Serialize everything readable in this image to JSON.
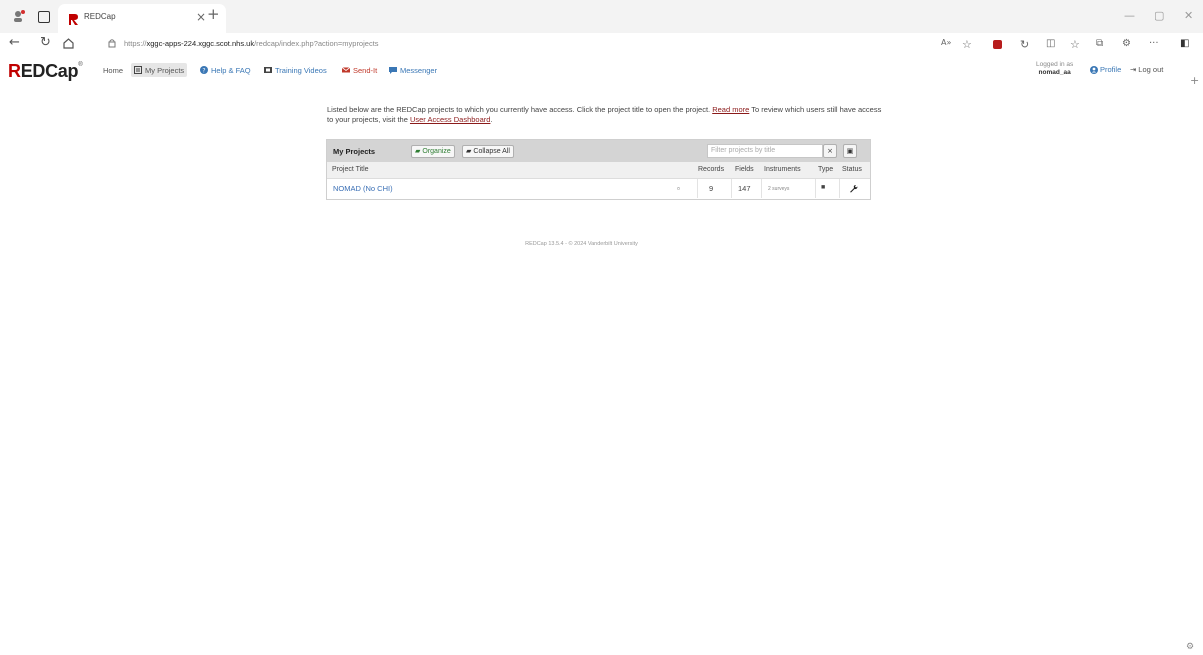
{
  "browser": {
    "tab_title": "REDCap",
    "url_prefix": "https://",
    "url_host": "xggc-apps-224.xggc.scot.nhs.uk",
    "url_path": "/redcap/index.php?action=myprojects"
  },
  "nav": {
    "logo_text": "EDCap",
    "logo_r": "R",
    "home": "Home",
    "my_projects": "My Projects",
    "help": "Help & FAQ",
    "training": "Training Videos",
    "sendit": "Send-It",
    "messenger": "Messenger",
    "logged_in_label": "Logged in as",
    "username": "nomad_aa",
    "profile": "Profile",
    "logout": "Log out"
  },
  "intro": {
    "text1": "Listed below are the REDCap projects to which you currently have access. Click the project title to open the project.",
    "read_more": "Read more",
    "text2": "To review which users still have access to your projects, visit the",
    "dashboard_link": "User Access Dashboard",
    "text3": "."
  },
  "projects": {
    "header_title": "My Projects",
    "organize": "Organize",
    "collapse_all": "Collapse All",
    "filter_placeholder": "Filter projects by title",
    "clear_btn": "×",
    "columns": {
      "title": "Project Title",
      "records": "Records",
      "fields": "Fields",
      "instruments": "Instruments",
      "type": "Type",
      "status": "Status"
    },
    "rows": [
      {
        "title": "NOMAD (No CHI)",
        "records": "9",
        "fields": "147",
        "instruments": "2 surveys"
      }
    ]
  },
  "footer": "REDCap 13.5.4 - © 2024 Vanderbilt University",
  "colors": {
    "brand_red": "#c00000",
    "link_blue": "#3a77b5",
    "header_grey": "#d4d4d4"
  }
}
